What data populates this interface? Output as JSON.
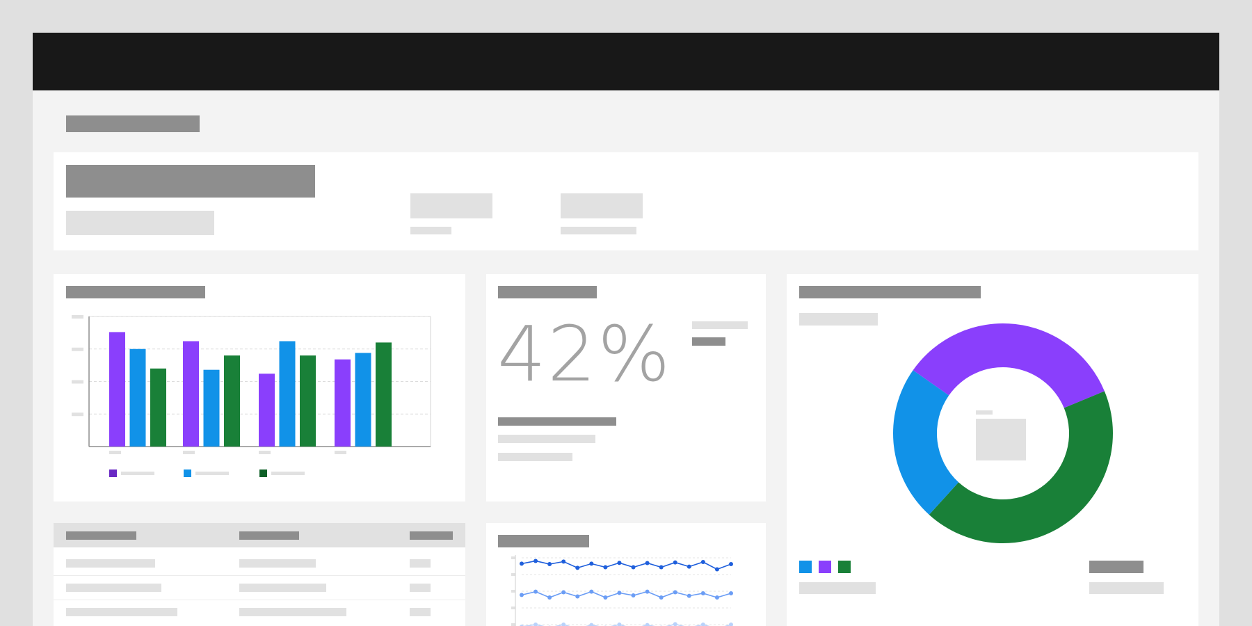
{
  "theme": {
    "topbar": "#181818",
    "canvas": "#f3f3f3",
    "card": "#ffffff",
    "placeholder_dark": "#8e8e8e",
    "placeholder_light": "#e1e1e1",
    "purple": "#8a3ffc",
    "blue": "#1192e8",
    "green": "#198038"
  },
  "kpi": {
    "value": "42%"
  },
  "chart_data": [
    {
      "type": "bar",
      "categories": [
        "",
        "",
        "",
        ""
      ],
      "series": [
        {
          "color": "#8a3ffc",
          "values": [
            0.88,
            0.81,
            0.56,
            0.67
          ]
        },
        {
          "color": "#1192e8",
          "values": [
            0.75,
            0.59,
            0.81,
            0.72
          ]
        },
        {
          "color": "#198038",
          "values": [
            0.6,
            0.7,
            0.7,
            0.8
          ]
        }
      ],
      "ylim": [
        0,
        1
      ],
      "grid": true,
      "legend": "bottom"
    },
    {
      "type": "pie",
      "donut": true,
      "slices": [
        {
          "color": "#8a3ffc",
          "value": 0.34
        },
        {
          "color": "#198038",
          "value": 0.43
        },
        {
          "color": "#1192e8",
          "value": 0.23
        }
      ],
      "legend": "bottom-left"
    },
    {
      "type": "line",
      "series": [
        {
          "color": "#1f5fdc",
          "values": [
            0.72,
            0.85,
            0.7,
            0.82,
            0.52,
            0.72,
            0.55,
            0.76,
            0.55,
            0.75,
            0.55,
            0.78,
            0.58,
            0.8,
            0.45,
            0.7
          ]
        },
        {
          "color": "#6b9df5",
          "values": [
            0.42,
            0.58,
            0.3,
            0.55,
            0.35,
            0.58,
            0.3,
            0.52,
            0.4,
            0.58,
            0.3,
            0.55,
            0.38,
            0.5,
            0.3,
            0.5
          ]
        },
        {
          "color": "#b9d2fb",
          "values": [
            0.1,
            0.2,
            0.05,
            0.2,
            0.0,
            0.18,
            0.05,
            0.2,
            0.0,
            0.18,
            0.05,
            0.22,
            0.05,
            0.2,
            0.0,
            0.2
          ]
        }
      ],
      "ylim": [
        0,
        1
      ],
      "grid": true
    }
  ]
}
